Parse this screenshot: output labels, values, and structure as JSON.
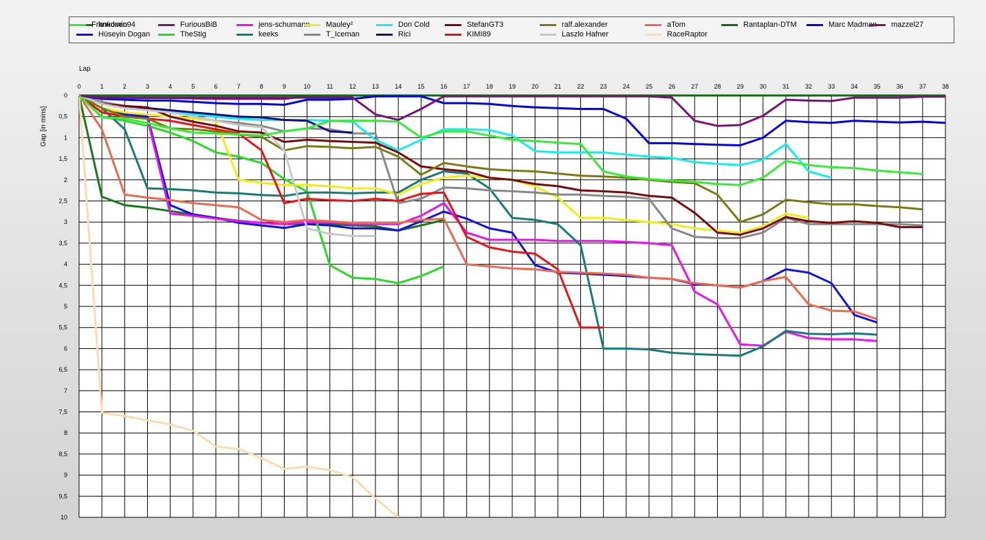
{
  "chart_data": {
    "type": "line",
    "xlabel": "Lap",
    "ylabel": "Gap [in mins]",
    "xlim": [
      0,
      38
    ],
    "ylim": [
      0,
      10
    ],
    "y_inverted": true,
    "x_ticks": [
      0,
      1,
      2,
      3,
      4,
      5,
      6,
      7,
      8,
      9,
      10,
      11,
      12,
      13,
      14,
      15,
      16,
      17,
      18,
      19,
      20,
      21,
      22,
      23,
      24,
      25,
      26,
      27,
      28,
      29,
      30,
      31,
      32,
      33,
      34,
      35,
      36,
      37,
      38
    ],
    "y_ticks": [
      "0",
      "0,5",
      "1",
      "1,5",
      "2",
      "2,5",
      "3",
      "3,5",
      "4",
      "4,5",
      "5",
      "5,5",
      "6",
      "6,5",
      "7",
      "7,5",
      "8",
      "8,5",
      "9",
      "9,5",
      "10"
    ],
    "grid": true,
    "legend_position": "top",
    "series": [
      {
        "name": "knudsen94",
        "color": "#157a15",
        "values": [
          0,
          2.4,
          2.6,
          2.66,
          2.74,
          2.82,
          2.9,
          2.97,
          3.02,
          3.05,
          3.05,
          3.05,
          3.08,
          3.1,
          3.2,
          3.08,
          2.95
        ]
      },
      {
        "name": "Hüseyin  Dogan",
        "color": "#1010e8",
        "values": [
          0,
          0.3,
          0.45,
          0.5,
          2.6,
          2.82,
          2.9,
          3.02,
          3.08,
          3.14,
          3.05,
          3.08,
          3.15,
          3.15,
          3.2,
          2.98,
          2.75,
          2.92,
          3.15,
          3.25,
          4.02,
          4.2,
          4.22,
          4.25,
          4.28,
          4.32,
          4.35,
          4.47,
          4.5,
          4.55,
          4.4,
          4.12,
          4.2,
          4.45,
          5.2,
          5.38
        ]
      },
      {
        "name": "FuriousBiB",
        "color": "#7a127a",
        "values": [
          0,
          0.05,
          0.05,
          0.06,
          0.06,
          0.07,
          0.08,
          0.08,
          0.08,
          0.08,
          0.02,
          0.02,
          0.02
        ]
      },
      {
        "name": "TheStig",
        "color": "#22dd22",
        "values": [
          0,
          0.5,
          0.6,
          0.72,
          0.88,
          1.08,
          1.35,
          1.45,
          1.6,
          1.98,
          2.28,
          4.02,
          4.32,
          4.35,
          4.45,
          4.28,
          4.05
        ]
      },
      {
        "name": "jens-schumann",
        "color": "#ee10ee",
        "values": [
          0,
          0.4,
          0.5,
          0.55,
          2.8,
          2.85,
          2.92,
          2.98,
          3.02,
          3.05,
          3.0,
          3.0,
          3.05,
          3.05,
          3.05,
          2.85,
          2.55,
          3.25,
          3.42,
          3.42,
          3.42,
          3.45,
          3.45,
          3.45,
          3.47,
          3.5,
          3.55,
          4.65,
          4.95,
          5.9,
          5.93,
          5.6,
          5.75,
          5.78,
          5.78,
          5.82
        ]
      },
      {
        "name": "keeks",
        "color": "#147a7a",
        "values": [
          0,
          0.3,
          0.8,
          2.2,
          2.22,
          2.25,
          2.3,
          2.32,
          2.36,
          2.38,
          2.3,
          2.3,
          2.32,
          2.3,
          2.3,
          2.0,
          1.8,
          1.85,
          2.2,
          2.9,
          2.95,
          3.05,
          3.55,
          6.0,
          6.0,
          6.02,
          6.1,
          6.13,
          6.15,
          6.17,
          5.95,
          5.58,
          5.65,
          5.66,
          5.64,
          5.67
        ]
      },
      {
        "name": "Mauley²",
        "color": "#eeee10",
        "values": [
          0,
          0.3,
          0.4,
          0.45,
          0.5,
          0.55,
          0.6,
          2.0,
          2.07,
          2.12,
          2.12,
          2.15,
          2.2,
          2.2,
          2.35,
          2.1,
          1.95,
          1.9,
          1.95,
          2.0,
          2.15,
          2.42,
          2.9,
          2.9,
          2.95,
          3.0,
          3.05,
          3.15,
          3.2,
          3.25,
          3.1,
          2.8,
          2.9
        ]
      },
      {
        "name": "T_Iceman",
        "color": "#888888",
        "values": [
          0,
          0.15,
          0.25,
          0.3,
          0.4,
          0.5,
          0.6,
          0.65,
          0.72,
          0.85,
          0.78,
          0.8,
          0.9,
          0.9,
          2.55,
          2.45,
          2.18,
          2.2,
          2.25,
          2.27,
          2.3,
          2.35,
          2.35,
          2.38,
          2.4,
          2.45,
          3.15,
          3.35,
          3.38,
          3.38,
          3.25,
          2.9,
          3.05,
          3.05,
          3.05,
          3.05,
          3.05,
          3.08
        ]
      },
      {
        "name": "Don Cold",
        "color": "#10eeee",
        "values": [
          0,
          0.2,
          0.3,
          0.35,
          0.4,
          0.45,
          0.5,
          0.55,
          0.58,
          0.58,
          0.58,
          0.6,
          0.62,
          1.05,
          1.3,
          1.05,
          0.8,
          0.8,
          0.82,
          0.95,
          1.32,
          1.35,
          1.35,
          1.35,
          1.4,
          1.45,
          1.48,
          1.58,
          1.62,
          1.65,
          1.52,
          1.15,
          1.8,
          1.95
        ]
      },
      {
        "name": "Rici",
        "color": "#101080",
        "values": [
          0,
          0.2,
          0.25,
          0.3,
          0.35,
          0.4,
          0.45,
          0.5,
          0.52,
          0.58,
          0.6,
          0.85,
          0.88
        ]
      },
      {
        "name": "StefanGT3",
        "color": "#7a0a0a",
        "values": [
          0,
          0.2,
          0.25,
          0.28,
          0.5,
          0.62,
          0.72,
          0.85,
          0.88,
          1.1,
          1.05,
          1.08,
          1.1,
          1.12,
          1.35,
          1.68,
          1.75,
          1.8,
          1.95,
          2.0,
          2.1,
          2.15,
          2.25,
          2.27,
          2.3,
          2.38,
          2.42,
          2.78,
          3.25,
          3.3,
          3.15,
          2.88,
          2.98,
          3.02,
          2.98,
          3.02,
          3.12,
          3.12
        ]
      },
      {
        "name": "KIMI89",
        "color": "#ee1010",
        "values": [
          0,
          0.4,
          0.5,
          0.55,
          0.6,
          0.7,
          0.8,
          0.9,
          1.3,
          2.55,
          2.45,
          2.48,
          2.5,
          2.45,
          2.5,
          2.33,
          2.3,
          3.35,
          3.6,
          3.7,
          3.75,
          4.12,
          5.5,
          5.5
        ]
      },
      {
        "name": "ralf.alexander",
        "color": "#7a7a10",
        "values": [
          0,
          0.3,
          0.5,
          0.55,
          0.78,
          0.8,
          0.85,
          0.92,
          0.98,
          1.3,
          1.2,
          1.22,
          1.25,
          1.22,
          1.45,
          1.88,
          1.6,
          1.68,
          1.75,
          1.78,
          1.8,
          1.85,
          1.9,
          1.92,
          1.95,
          2.0,
          2.05,
          2.08,
          2.35,
          3.0,
          2.82,
          2.47,
          2.53,
          2.58,
          2.58,
          2.62,
          2.65,
          2.7
        ]
      },
      {
        "name": "Laszlo Hafner",
        "color": "#c8c8c8",
        "values": [
          0,
          0.2,
          0.3,
          0.35,
          0.4,
          0.5,
          0.6,
          0.7,
          0.75,
          1.3,
          3.15,
          3.28,
          3.33,
          3.33
        ]
      },
      {
        "name": "aTom",
        "color": "#f0684c",
        "values": [
          0,
          0.8,
          2.35,
          2.42,
          2.48,
          2.55,
          2.6,
          2.65,
          2.95,
          3.0,
          2.95,
          2.98,
          3.02,
          3.02,
          3.02,
          2.95,
          2.92,
          4.0,
          4.05,
          4.1,
          4.12,
          4.18,
          4.2,
          4.22,
          4.25,
          4.32,
          4.35,
          4.45,
          4.5,
          4.55,
          4.4,
          4.3,
          4.95,
          5.1,
          5.12,
          5.3
        ]
      },
      {
        "name": "RaceRaptor",
        "color": "#fadcb0",
        "values": [
          0,
          7.52,
          7.6,
          7.7,
          7.8,
          7.95,
          8.32,
          8.38,
          8.6,
          8.85,
          8.8,
          8.88,
          9.05,
          9.55,
          10.0
        ]
      },
      {
        "name": "Rantaplan-DTM",
        "color": "#0a6e0a",
        "values": [
          0,
          0,
          0,
          0,
          0,
          0,
          0,
          0,
          0,
          0,
          0,
          0,
          0,
          0,
          0,
          0,
          0,
          0,
          0,
          0,
          0,
          0,
          0,
          0,
          0,
          0,
          0,
          0,
          0,
          0,
          0,
          0,
          0,
          0,
          0,
          0,
          0,
          0,
          0
        ]
      },
      {
        "name": "Marc Madman",
        "color": "#0000f0",
        "values": [
          0,
          0.08,
          0.1,
          0.12,
          0.12,
          0.15,
          0.18,
          0.2,
          0.2,
          0.22,
          0.1,
          0.1,
          0.08,
          0.02,
          0.02,
          0.02,
          0.18,
          0.18,
          0.2,
          0.25,
          0.28,
          0.3,
          0.32,
          0.32,
          0.55,
          1.13,
          1.13,
          1.15,
          1.17,
          1.18,
          1.0,
          0.6,
          0.63,
          0.65,
          0.6,
          0.62,
          0.64,
          0.62,
          0.65
        ]
      },
      {
        "name": "mazzel27",
        "color": "#7a107a",
        "values": [
          0,
          0.05,
          0.05,
          0.05,
          0.05,
          0.05,
          0.05,
          0.05,
          0.05,
          0.05,
          0.05,
          0.05,
          0.05,
          0.45,
          0.58,
          0.32,
          0.02,
          0.02,
          0.02,
          0.02,
          0.02,
          0.02,
          0.02,
          0.02,
          0.02,
          0.02,
          0.05,
          0.6,
          0.72,
          0.7,
          0.48,
          0.1,
          0.12,
          0.13,
          0.05,
          0.05,
          0.05,
          0.03,
          0.03
        ]
      },
      {
        "name": "Frankomio",
        "color": "#33ee33",
        "values": [
          0,
          0.52,
          0.55,
          0.65,
          0.78,
          0.88,
          0.9,
          0.92,
          0.95,
          0.85,
          0.78,
          0.6,
          0.6,
          0.6,
          0.62,
          1.0,
          0.85,
          0.85,
          0.95,
          1.05,
          1.08,
          1.12,
          1.15,
          1.8,
          1.92,
          1.98,
          2.02,
          2.05,
          2.1,
          2.12,
          1.95,
          1.55,
          1.65,
          1.7,
          1.72,
          1.78,
          1.82,
          1.86
        ]
      }
    ]
  }
}
